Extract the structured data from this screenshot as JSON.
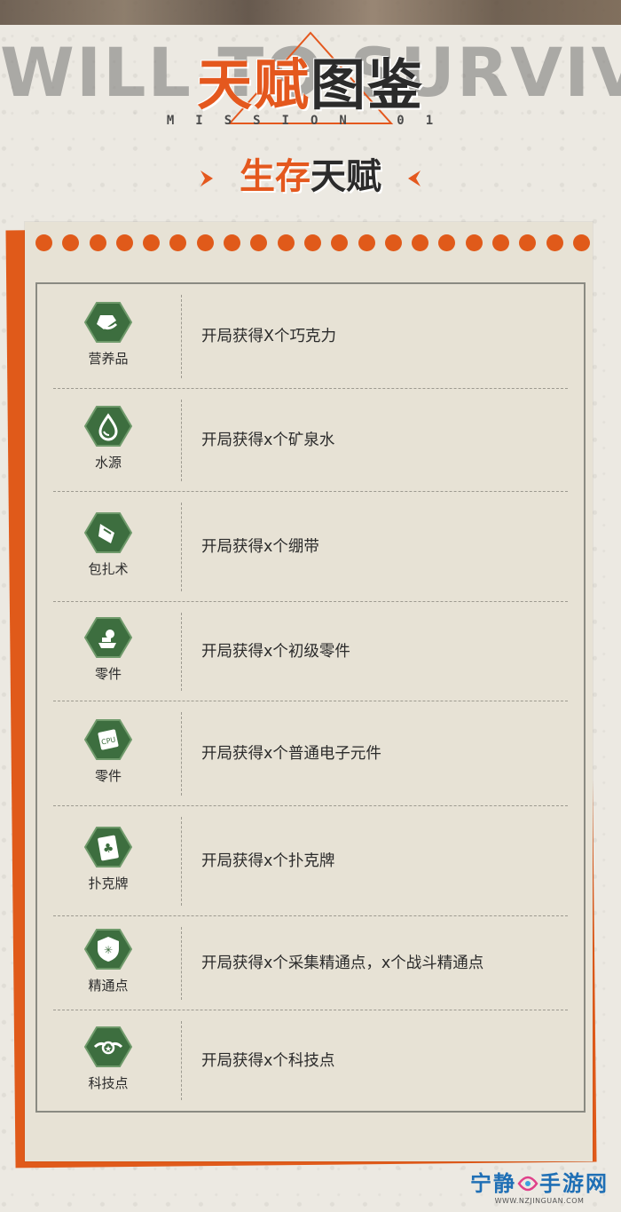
{
  "header": {
    "bg_title": "WILL TO SURVIVE",
    "title_orange": "天赋",
    "title_dark": "图鉴",
    "mission": "MISSION 01",
    "section_orange": "生存",
    "section_dark": "天赋"
  },
  "rows": [
    {
      "icon": "chocolate-icon",
      "label": "营养品",
      "desc": "开局获得X个巧克力"
    },
    {
      "icon": "water-drop-icon",
      "label": "水源",
      "desc": "开局获得x个矿泉水"
    },
    {
      "icon": "bandage-icon",
      "label": "包扎术",
      "desc": "开局获得x个绷带"
    },
    {
      "icon": "parts-icon",
      "label": "零件",
      "desc": "开局获得x个初级零件"
    },
    {
      "icon": "chip-icon",
      "label": "零件",
      "desc": "开局获得x个普通电子元件"
    },
    {
      "icon": "playing-card-icon",
      "label": "扑克牌",
      "desc": "开局获得x个扑克牌"
    },
    {
      "icon": "mastery-badge-icon",
      "label": "精通点",
      "desc": "开局获得x个采集精通点，x个战斗精通点"
    },
    {
      "icon": "tech-wings-icon",
      "label": "科技点",
      "desc": "开局获得x个科技点"
    }
  ],
  "watermark": {
    "name_left": "宁静",
    "name_right": "手游网",
    "url": "WWW.NZJINGUAN.COM"
  },
  "colors": {
    "accent": "#e05a1a",
    "icon_green": "#3d6e3f",
    "text": "#2b2b2b"
  }
}
